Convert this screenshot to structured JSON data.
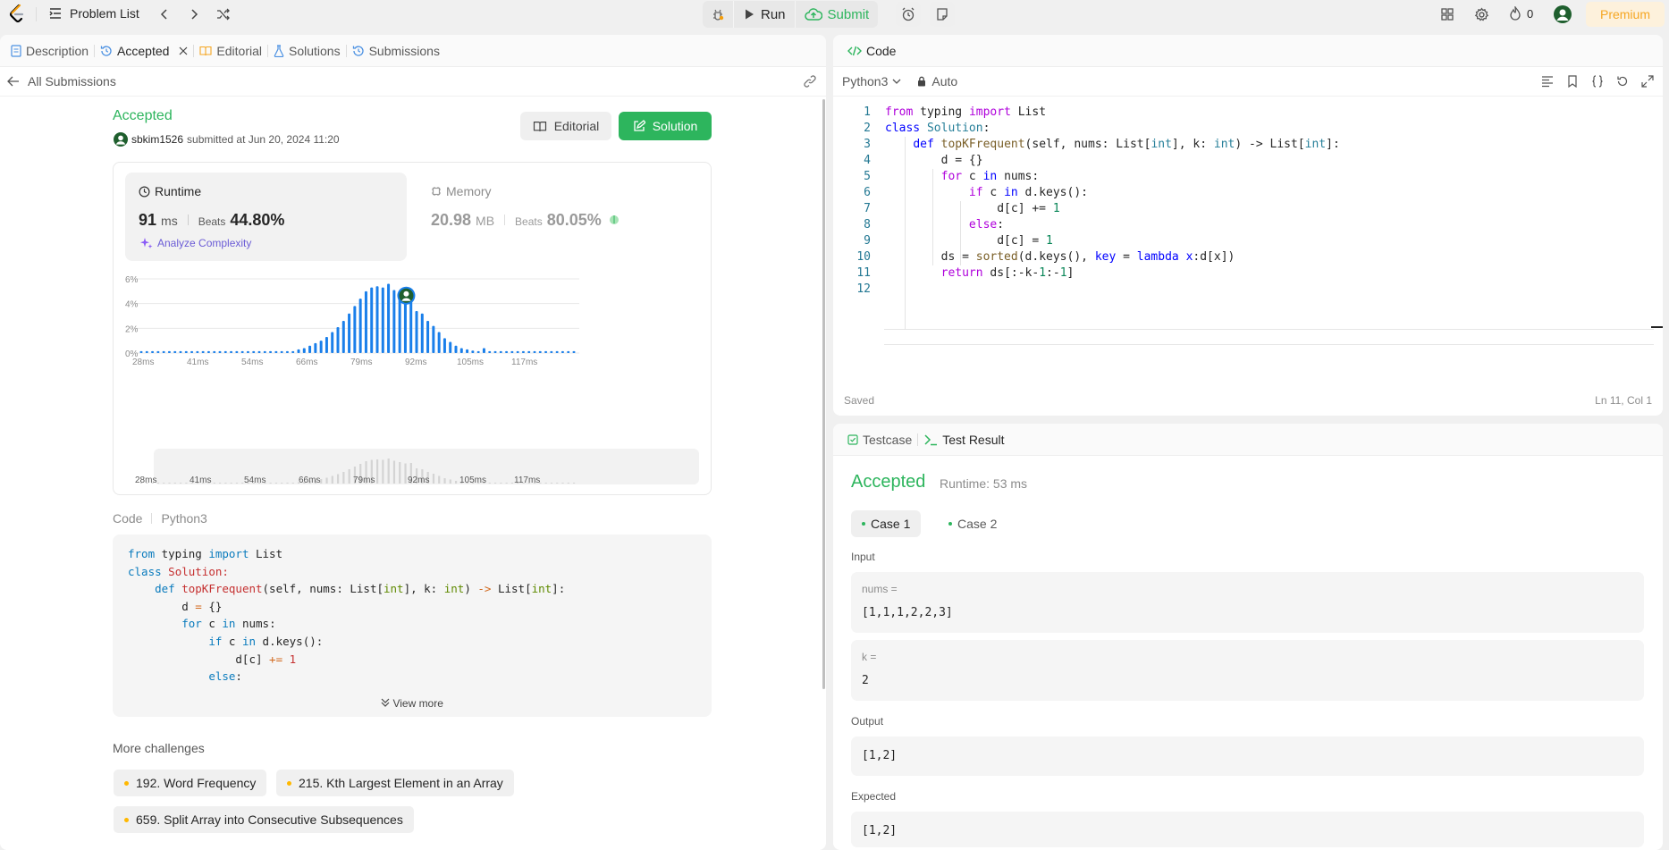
{
  "topbar": {
    "problem_list": "Problem List",
    "run": "Run",
    "submit": "Submit",
    "streak": "0",
    "premium": "Premium"
  },
  "left_tabs": [
    {
      "label": "Description"
    },
    {
      "label": "Accepted"
    },
    {
      "label": "Editorial"
    },
    {
      "label": "Solutions"
    },
    {
      "label": "Submissions"
    }
  ],
  "submission": {
    "back_label": "All Submissions",
    "status": "Accepted",
    "user": "sbkim1526",
    "submitted_text": "submitted at Jun 20, 2024 11:20",
    "editorial_btn": "Editorial",
    "solution_btn": "Solution"
  },
  "runtime": {
    "label": "Runtime",
    "value": "91",
    "unit": "ms",
    "beats_label": "Beats",
    "beats": "44.80%",
    "analyze": "Analyze Complexity"
  },
  "memory": {
    "label": "Memory",
    "value": "20.98",
    "unit": "MB",
    "beats_label": "Beats",
    "beats": "80.05%"
  },
  "chart_data": {
    "type": "bar",
    "xlabel": "",
    "ylabel": "",
    "ylim": [
      0,
      6
    ],
    "y_ticks": [
      "6%",
      "4%",
      "2%",
      "0%"
    ],
    "x_tick_labels": [
      "28ms",
      "41ms",
      "54ms",
      "66ms",
      "79ms",
      "92ms",
      "105ms",
      "117ms"
    ],
    "values": [
      0.15,
      0.15,
      0.15,
      0.15,
      0.15,
      0.15,
      0.15,
      0.15,
      0.15,
      0.15,
      0.15,
      0.15,
      0.15,
      0.15,
      0.15,
      0.15,
      0.15,
      0.15,
      0.15,
      0.15,
      0.15,
      0.15,
      0.15,
      0.15,
      0.15,
      0.15,
      0.15,
      0.15,
      0.3,
      0.4,
      0.6,
      0.8,
      1.0,
      1.3,
      1.7,
      2.1,
      2.6,
      3.2,
      3.8,
      4.4,
      5.0,
      5.3,
      5.4,
      5.3,
      5.6,
      5.1,
      4.8,
      4.5,
      4.6,
      3.4,
      3.2,
      2.6,
      2.2,
      1.7,
      1.2,
      0.9,
      0.6,
      0.4,
      0.3,
      0.2,
      0.15,
      0.4,
      0.15,
      0.15,
      0.15,
      0.15,
      0.15,
      0.15,
      0.15,
      0.15,
      0.15,
      0.15,
      0.15,
      0.15,
      0.15,
      0.15,
      0.15,
      0.15
    ],
    "highlight_index": 47,
    "grid": true
  },
  "code_preview": {
    "header_code": "Code",
    "header_lang": "Python3",
    "view_more": "View more"
  },
  "more_challenges": {
    "title": "More challenges",
    "items": [
      "192. Word Frequency",
      "215. Kth Largest Element in an Array",
      "659. Split Array into Consecutive Subsequences"
    ]
  },
  "editor": {
    "title": "Code",
    "language": "Python3",
    "mode": "Auto",
    "saved": "Saved",
    "cursor": "Ln 11, Col 1"
  },
  "result": {
    "tab_testcase": "Testcase",
    "tab_result": "Test Result",
    "status": "Accepted",
    "runtime": "Runtime: 53 ms",
    "case1": "Case 1",
    "case2": "Case 2",
    "input_label": "Input",
    "nums_key": "nums =",
    "nums_val": "[1,1,1,2,2,3]",
    "k_key": "k =",
    "k_val": "2",
    "output_label": "Output",
    "output_val": "[1,2]",
    "expected_label": "Expected",
    "expected_val": "[1,2]"
  },
  "colors": {
    "accent_green": "#2db55d",
    "bar_blue": "#1a7fea",
    "premium_orange": "#f5a623"
  }
}
